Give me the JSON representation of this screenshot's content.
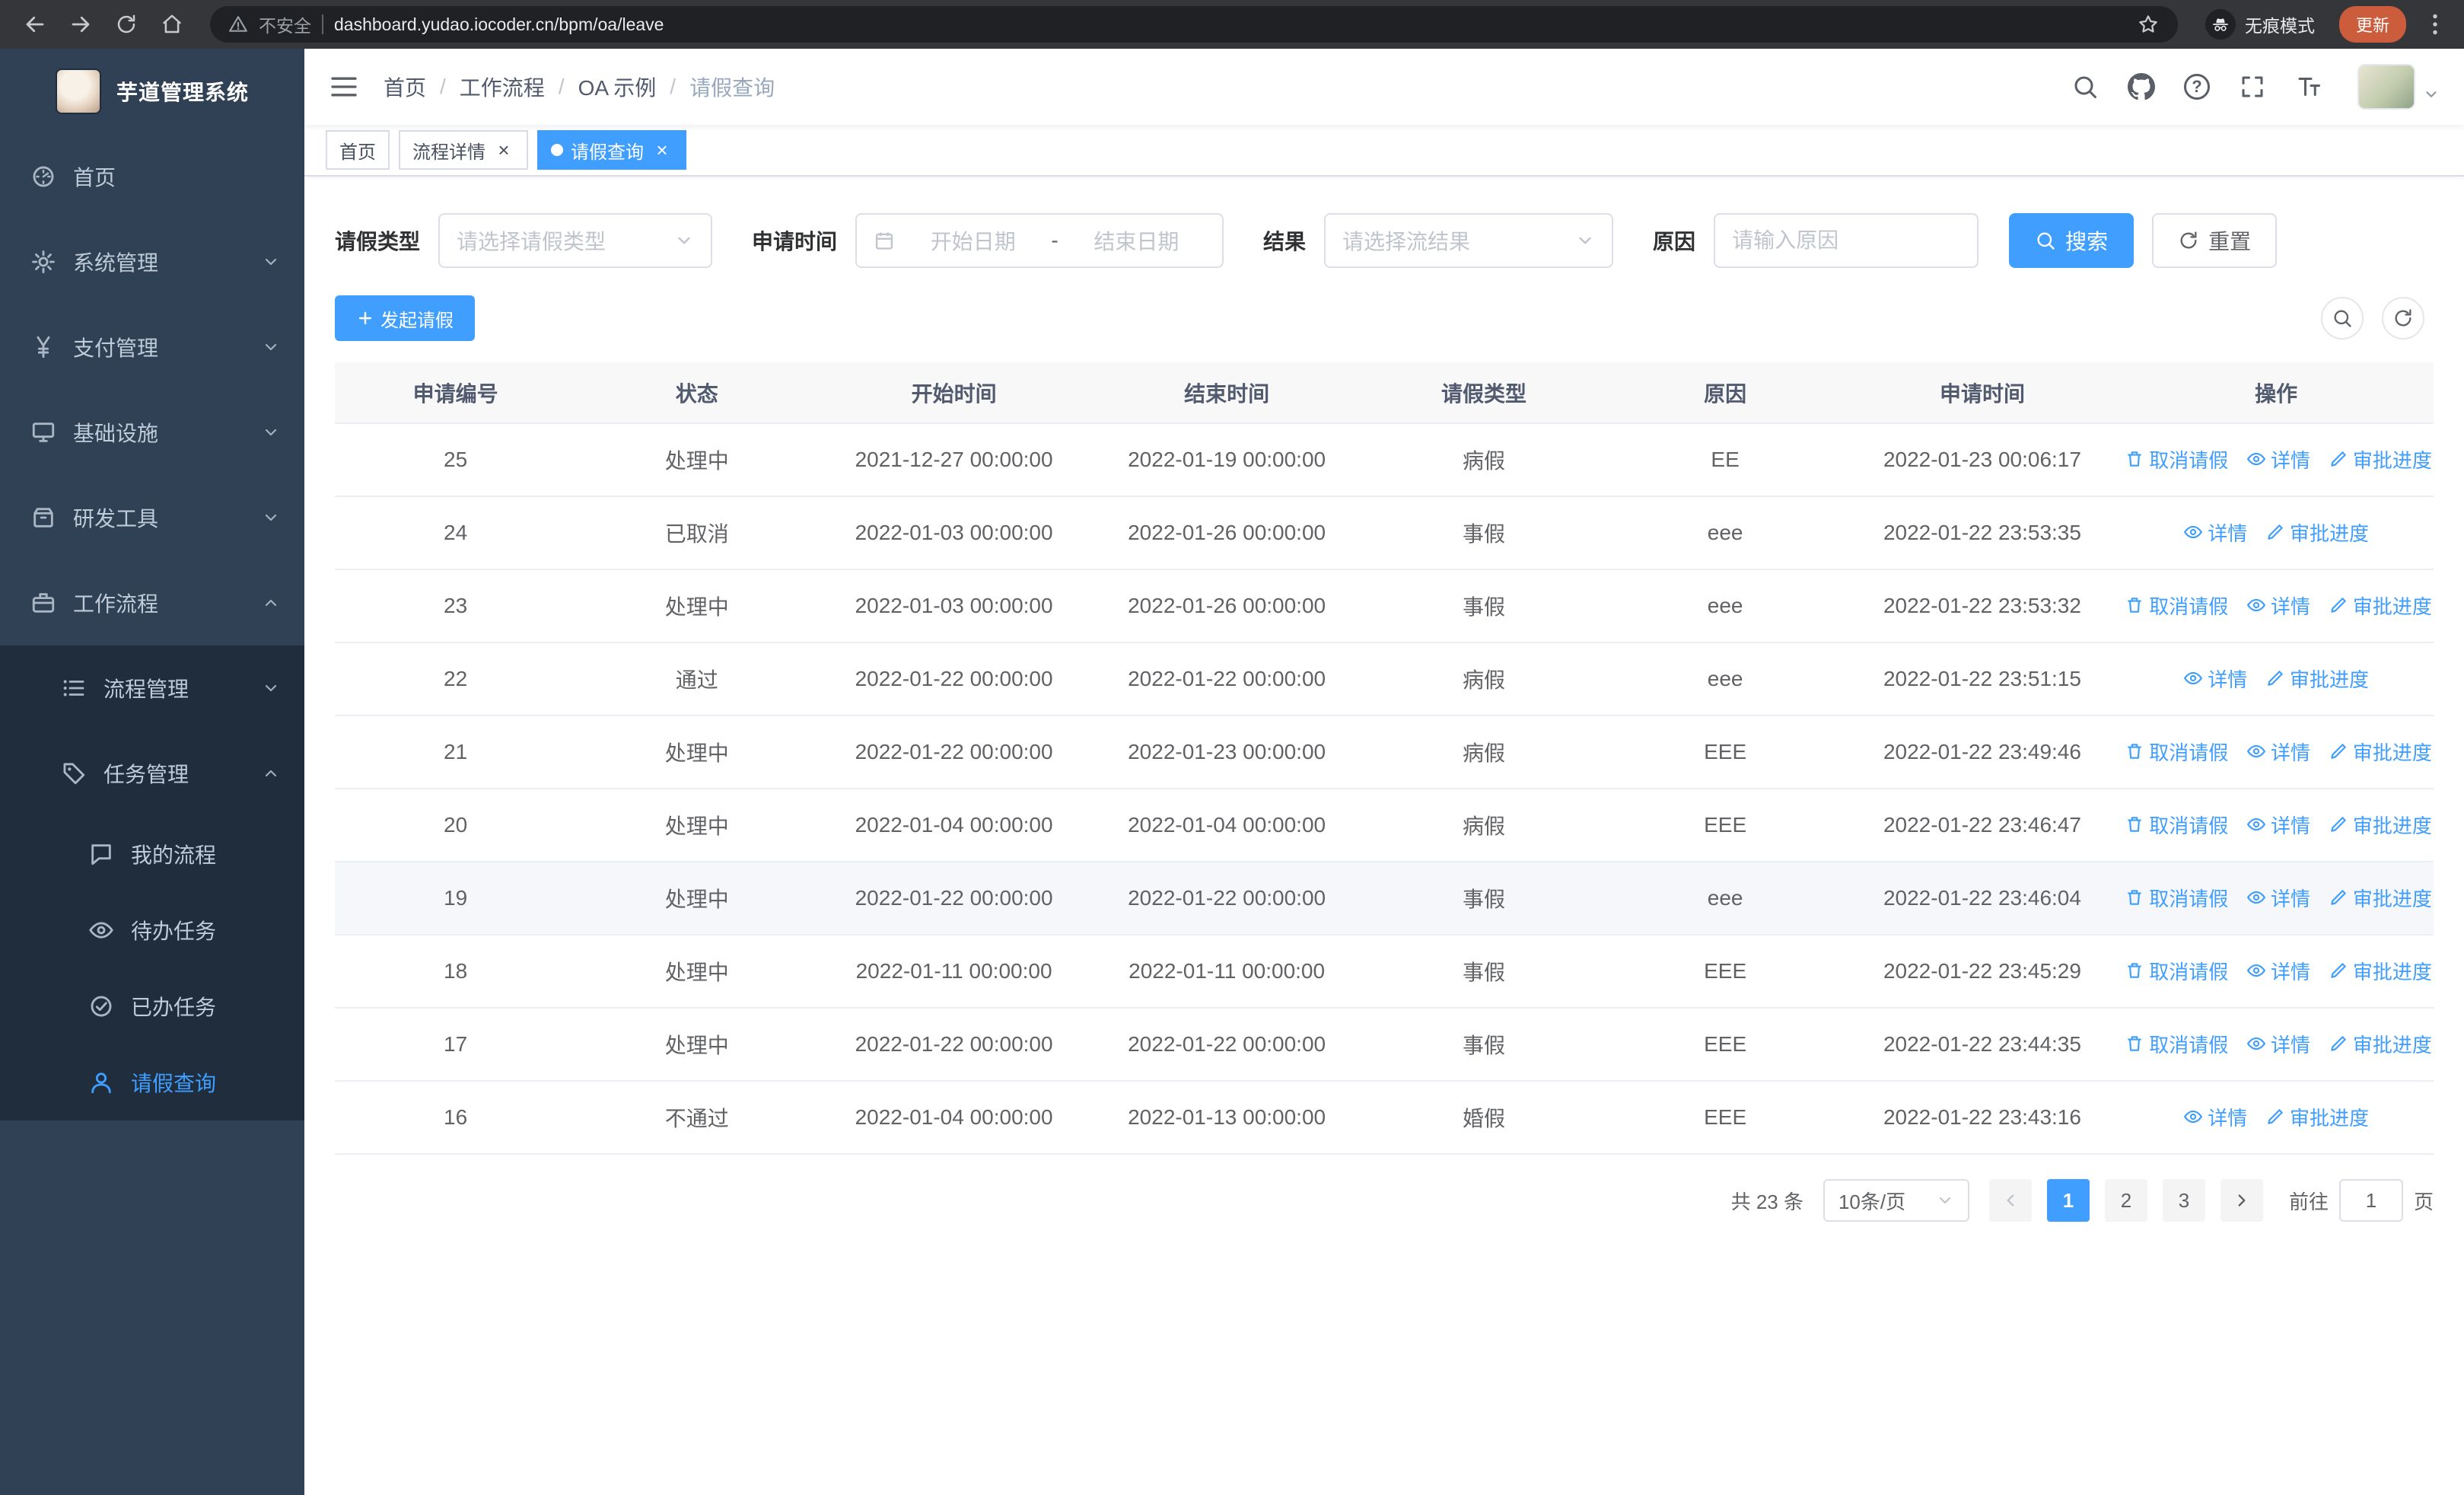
{
  "colors": {
    "primary": "#409eff",
    "sidebar_bg": "#304156",
    "sidebar_submenu_bg": "#1f2d3d",
    "active_tab_bg": "#409eff"
  },
  "browser": {
    "security_warning": "不安全",
    "url": "dashboard.yudao.iocoder.cn/bpm/oa/leave",
    "incognito_label": "无痕模式",
    "update_button": "更新"
  },
  "sidebar": {
    "logo_title": "芋道管理系统",
    "items": [
      {
        "label": "首页",
        "icon": "dashboard-icon"
      },
      {
        "label": "系统管理",
        "icon": "gear-icon"
      },
      {
        "label": "支付管理",
        "icon": "yen-icon"
      },
      {
        "label": "基础设施",
        "icon": "monitor-icon"
      },
      {
        "label": "研发工具",
        "icon": "toolbox-icon"
      },
      {
        "label": "工作流程",
        "icon": "briefcase-icon"
      },
      {
        "label": "流程管理",
        "icon": "list-icon"
      },
      {
        "label": "任务管理",
        "icon": "tag-icon"
      },
      {
        "label": "我的流程",
        "icon": "chat-icon"
      },
      {
        "label": "待办任务",
        "icon": "eye-icon"
      },
      {
        "label": "已办任务",
        "icon": "check-circle-icon"
      },
      {
        "label": "请假查询",
        "icon": "user-icon"
      }
    ]
  },
  "header": {
    "breadcrumb": [
      "首页",
      "工作流程",
      "OA 示例",
      "请假查询"
    ],
    "separator": "/",
    "help_glyph": "?"
  },
  "tabs": [
    {
      "label": "首页",
      "closable": false,
      "active": false
    },
    {
      "label": "流程详情",
      "closable": true,
      "active": false
    },
    {
      "label": "请假查询",
      "closable": true,
      "active": true
    }
  ],
  "tab_close_glyph": "×",
  "filters": {
    "leave_type_label": "请假类型",
    "leave_type_placeholder": "请选择请假类型",
    "apply_time_label": "申请时间",
    "start_date_placeholder": "开始日期",
    "range_separator": "-",
    "end_date_placeholder": "结束日期",
    "result_label": "结果",
    "result_placeholder": "请选择流结果",
    "reason_label": "原因",
    "reason_placeholder": "请输入原因",
    "search_button": "搜索",
    "reset_button": "重置"
  },
  "toolbar": {
    "create_button": "发起请假"
  },
  "table": {
    "columns": [
      "申请编号",
      "状态",
      "开始时间",
      "结束时间",
      "请假类型",
      "原因",
      "申请时间",
      "操作"
    ],
    "actions": {
      "cancel": "取消请假",
      "detail": "详情",
      "progress": "审批进度"
    },
    "rows": [
      {
        "id": "25",
        "status": "处理中",
        "start": "2021-12-27 00:00:00",
        "end": "2022-01-19 00:00:00",
        "type": "病假",
        "reason": "EE",
        "apply_time": "2022-01-23 00:06:17",
        "can_cancel": true,
        "hover": false
      },
      {
        "id": "24",
        "status": "已取消",
        "start": "2022-01-03 00:00:00",
        "end": "2022-01-26 00:00:00",
        "type": "事假",
        "reason": "eee",
        "apply_time": "2022-01-22 23:53:35",
        "can_cancel": false,
        "hover": false
      },
      {
        "id": "23",
        "status": "处理中",
        "start": "2022-01-03 00:00:00",
        "end": "2022-01-26 00:00:00",
        "type": "事假",
        "reason": "eee",
        "apply_time": "2022-01-22 23:53:32",
        "can_cancel": true,
        "hover": false
      },
      {
        "id": "22",
        "status": "通过",
        "start": "2022-01-22 00:00:00",
        "end": "2022-01-22 00:00:00",
        "type": "病假",
        "reason": "eee",
        "apply_time": "2022-01-22 23:51:15",
        "can_cancel": false,
        "hover": false
      },
      {
        "id": "21",
        "status": "处理中",
        "start": "2022-01-22 00:00:00",
        "end": "2022-01-23 00:00:00",
        "type": "病假",
        "reason": "EEE",
        "apply_time": "2022-01-22 23:49:46",
        "can_cancel": true,
        "hover": false
      },
      {
        "id": "20",
        "status": "处理中",
        "start": "2022-01-04 00:00:00",
        "end": "2022-01-04 00:00:00",
        "type": "病假",
        "reason": "EEE",
        "apply_time": "2022-01-22 23:46:47",
        "can_cancel": true,
        "hover": false
      },
      {
        "id": "19",
        "status": "处理中",
        "start": "2022-01-22 00:00:00",
        "end": "2022-01-22 00:00:00",
        "type": "事假",
        "reason": "eee",
        "apply_time": "2022-01-22 23:46:04",
        "can_cancel": true,
        "hover": true
      },
      {
        "id": "18",
        "status": "处理中",
        "start": "2022-01-11 00:00:00",
        "end": "2022-01-11 00:00:00",
        "type": "事假",
        "reason": "EEE",
        "apply_time": "2022-01-22 23:45:29",
        "can_cancel": true,
        "hover": false
      },
      {
        "id": "17",
        "status": "处理中",
        "start": "2022-01-22 00:00:00",
        "end": "2022-01-22 00:00:00",
        "type": "事假",
        "reason": "EEE",
        "apply_time": "2022-01-22 23:44:35",
        "can_cancel": true,
        "hover": false
      },
      {
        "id": "16",
        "status": "不通过",
        "start": "2022-01-04 00:00:00",
        "end": "2022-01-13 00:00:00",
        "type": "婚假",
        "reason": "EEE",
        "apply_time": "2022-01-22 23:43:16",
        "can_cancel": false,
        "hover": false
      }
    ]
  },
  "pagination": {
    "total_text": "共 23 条",
    "page_size": "10条/页",
    "pages": [
      "1",
      "2",
      "3"
    ],
    "active_page": "1",
    "goto_label": "前往",
    "goto_value": "1",
    "goto_suffix": "页"
  }
}
